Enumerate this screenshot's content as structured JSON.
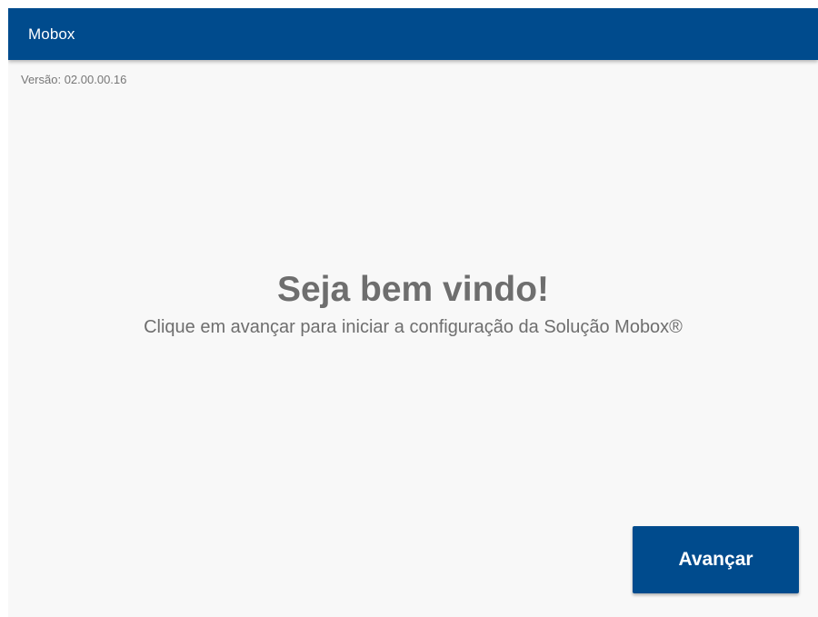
{
  "app_bar": {
    "title": "Mobox"
  },
  "version": {
    "text": "Versão: 02.00.00.16"
  },
  "welcome": {
    "title": "Seja bem vindo!",
    "subtitle": "Clique em avançar para iniciar a configuração da Solução Mobox®"
  },
  "actions": {
    "next_label": "Avançar"
  },
  "colors": {
    "primary": "#004b8d",
    "background": "#f8f8f8",
    "text_muted": "#6e6e6e"
  }
}
